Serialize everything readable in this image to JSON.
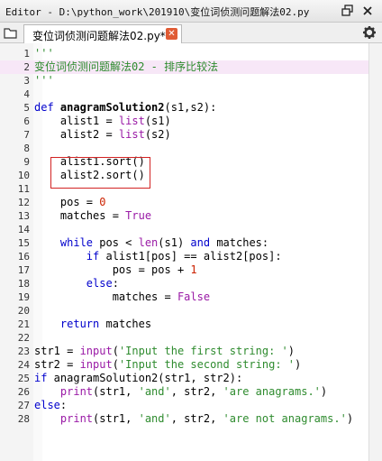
{
  "window": {
    "title": "Editor - D:\\python_work\\201910\\变位词侦测问题解法02.py",
    "restore_icon": "restore-window-icon",
    "close_icon": "close-window-icon"
  },
  "tab": {
    "label": "变位词侦测问题解法02.py*",
    "close_icon": "tab-close-icon"
  },
  "toolbar": {
    "left_icon": "folder-icon",
    "right_icon": "gear-icon"
  },
  "editor": {
    "current_line": 2,
    "highlighted_lines": [
      9,
      10
    ],
    "lines": [
      {
        "n": "1",
        "segs": [
          {
            "c": "dq",
            "t": "'''"
          }
        ]
      },
      {
        "n": "2",
        "segs": [
          {
            "c": "s",
            "t": "变位词侦测问题解法02 - 排序比较法"
          }
        ]
      },
      {
        "n": "3",
        "segs": [
          {
            "c": "dq",
            "t": "'''"
          }
        ]
      },
      {
        "n": "4",
        "segs": []
      },
      {
        "n": "5",
        "segs": [
          {
            "c": "k",
            "t": "def "
          },
          {
            "c": "f",
            "t": "anagramSolution2"
          },
          {
            "c": "t",
            "t": "(s1,s2):"
          }
        ]
      },
      {
        "n": "6",
        "segs": [
          {
            "c": "t",
            "t": "    alist1 = "
          },
          {
            "c": "b",
            "t": "list"
          },
          {
            "c": "t",
            "t": "(s1)"
          }
        ]
      },
      {
        "n": "7",
        "segs": [
          {
            "c": "t",
            "t": "    alist2 = "
          },
          {
            "c": "b",
            "t": "list"
          },
          {
            "c": "t",
            "t": "(s2)"
          }
        ]
      },
      {
        "n": "8",
        "segs": []
      },
      {
        "n": "9",
        "segs": [
          {
            "c": "t",
            "t": "    alist1.sort()"
          }
        ]
      },
      {
        "n": "10",
        "segs": [
          {
            "c": "t",
            "t": "    alist2.sort()"
          }
        ]
      },
      {
        "n": "11",
        "segs": []
      },
      {
        "n": "12",
        "segs": [
          {
            "c": "t",
            "t": "    pos = "
          },
          {
            "c": "n",
            "t": "0"
          }
        ]
      },
      {
        "n": "13",
        "segs": [
          {
            "c": "t",
            "t": "    matches = "
          },
          {
            "c": "b",
            "t": "True"
          }
        ]
      },
      {
        "n": "14",
        "segs": []
      },
      {
        "n": "15",
        "segs": [
          {
            "c": "t",
            "t": "    "
          },
          {
            "c": "k",
            "t": "while"
          },
          {
            "c": "t",
            "t": " pos < "
          },
          {
            "c": "b",
            "t": "len"
          },
          {
            "c": "t",
            "t": "(s1) "
          },
          {
            "c": "k",
            "t": "and"
          },
          {
            "c": "t",
            "t": " matches:"
          }
        ]
      },
      {
        "n": "16",
        "segs": [
          {
            "c": "t",
            "t": "        "
          },
          {
            "c": "k",
            "t": "if"
          },
          {
            "c": "t",
            "t": " alist1[pos] == alist2[pos]:"
          }
        ]
      },
      {
        "n": "17",
        "segs": [
          {
            "c": "t",
            "t": "            pos = pos + "
          },
          {
            "c": "n",
            "t": "1"
          }
        ]
      },
      {
        "n": "18",
        "segs": [
          {
            "c": "t",
            "t": "        "
          },
          {
            "c": "k",
            "t": "else"
          },
          {
            "c": "t",
            "t": ":"
          }
        ]
      },
      {
        "n": "19",
        "segs": [
          {
            "c": "t",
            "t": "            matches = "
          },
          {
            "c": "b",
            "t": "False"
          }
        ]
      },
      {
        "n": "20",
        "segs": []
      },
      {
        "n": "21",
        "segs": [
          {
            "c": "t",
            "t": "    "
          },
          {
            "c": "k",
            "t": "return"
          },
          {
            "c": "t",
            "t": " matches"
          }
        ]
      },
      {
        "n": "22",
        "segs": []
      },
      {
        "n": "23",
        "segs": [
          {
            "c": "t",
            "t": "str1 = "
          },
          {
            "c": "b",
            "t": "input"
          },
          {
            "c": "t",
            "t": "("
          },
          {
            "c": "s",
            "t": "'Input the first string: '"
          },
          {
            "c": "t",
            "t": ")"
          }
        ]
      },
      {
        "n": "24",
        "segs": [
          {
            "c": "t",
            "t": "str2 = "
          },
          {
            "c": "b",
            "t": "input"
          },
          {
            "c": "t",
            "t": "("
          },
          {
            "c": "s",
            "t": "'Input the second string: '"
          },
          {
            "c": "t",
            "t": ")"
          }
        ]
      },
      {
        "n": "25",
        "segs": [
          {
            "c": "k",
            "t": "if"
          },
          {
            "c": "t",
            "t": " anagramSolution2(str1, str2):"
          }
        ]
      },
      {
        "n": "26",
        "segs": [
          {
            "c": "t",
            "t": "    "
          },
          {
            "c": "b",
            "t": "print"
          },
          {
            "c": "t",
            "t": "(str1, "
          },
          {
            "c": "s",
            "t": "'and'"
          },
          {
            "c": "t",
            "t": ", str2, "
          },
          {
            "c": "s",
            "t": "'are anagrams.'"
          },
          {
            "c": "t",
            "t": ")"
          }
        ]
      },
      {
        "n": "27",
        "segs": [
          {
            "c": "k",
            "t": "else"
          },
          {
            "c": "t",
            "t": ":"
          }
        ]
      },
      {
        "n": "28",
        "segs": [
          {
            "c": "t",
            "t": "    "
          },
          {
            "c": "b",
            "t": "print"
          },
          {
            "c": "t",
            "t": "(str1, "
          },
          {
            "c": "s",
            "t": "'and'"
          },
          {
            "c": "t",
            "t": ", str2, "
          },
          {
            "c": "s",
            "t": "'are not anagrams.'"
          },
          {
            "c": "t",
            "t": ")"
          }
        ]
      }
    ]
  },
  "colors": {
    "keyword": "#0000cc",
    "builtin": "#9a1aa6",
    "string": "#2e8b2e",
    "number": "#cc2200",
    "current_line_bg": "#f7e7f7",
    "annotation_box": "#d22323",
    "tab_close": "#e05b34"
  }
}
